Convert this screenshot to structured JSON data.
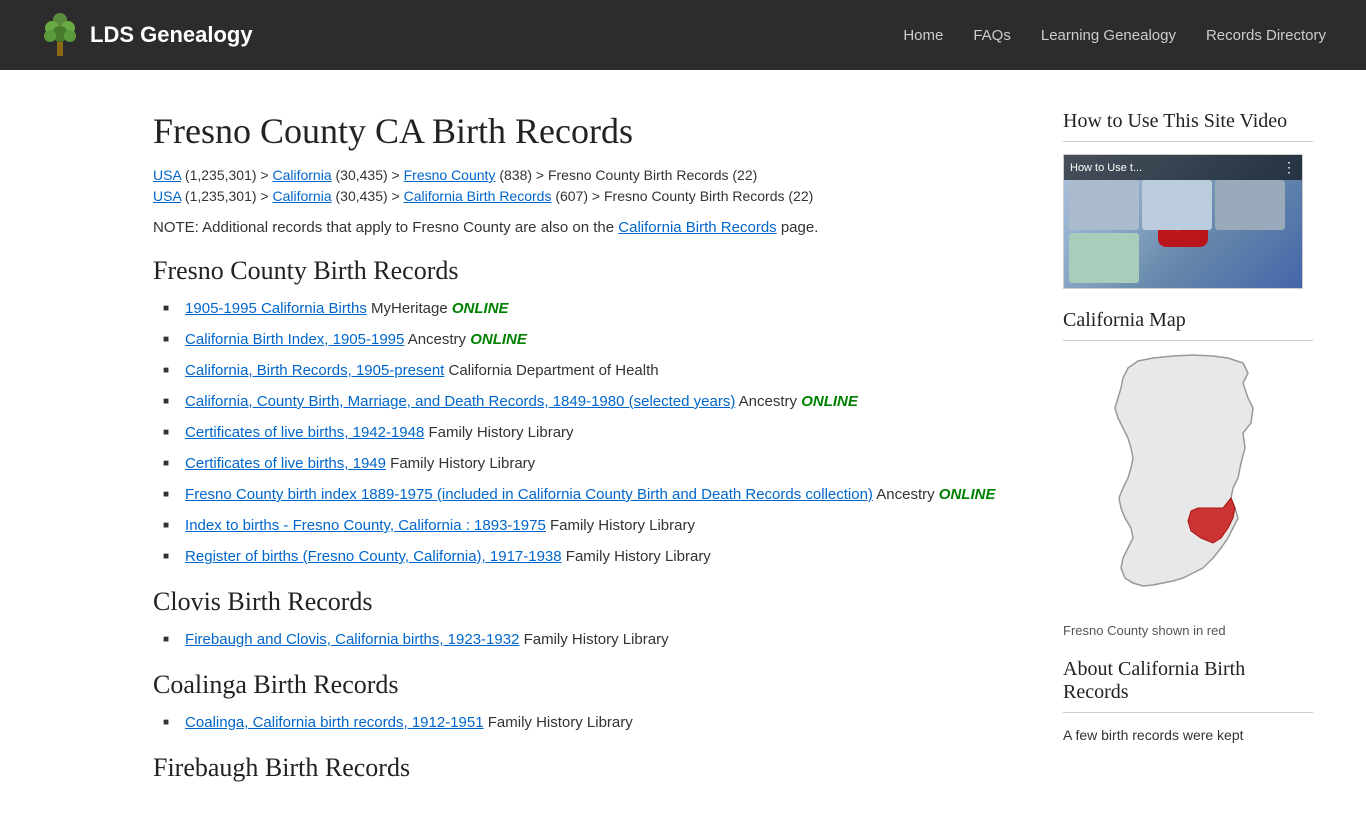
{
  "header": {
    "logo_text": "LDS Genealogy",
    "nav": [
      {
        "label": "Home",
        "key": "home"
      },
      {
        "label": "FAQs",
        "key": "faqs"
      },
      {
        "label": "Learning Genealogy",
        "key": "learning"
      },
      {
        "label": "Records Directory",
        "key": "records"
      }
    ]
  },
  "main": {
    "page_title": "Fresno County CA Birth Records",
    "breadcrumbs": [
      {
        "parts": [
          {
            "text": "USA",
            "link": true
          },
          " (1,235,301) > ",
          {
            "text": "California",
            "link": true
          },
          " (30,435) > ",
          {
            "text": "Fresno County",
            "link": true
          },
          " (838) > Fresno County Birth Records (22)"
        ],
        "raw": "USA (1,235,301) > California (30,435) > Fresno County (838) > Fresno County Birth Records (22)"
      },
      {
        "raw": "USA (1,235,301) > California (30,435) > California Birth Records (607) > Fresno County Birth Records (22)"
      }
    ],
    "note": "NOTE: Additional records that apply to Fresno County are also on the",
    "note_link": "California Birth Records",
    "note_end": "page.",
    "sections": [
      {
        "title": "Fresno County Birth Records",
        "records": [
          {
            "link_text": "1905-1995 California Births",
            "source": "MyHeritage",
            "online": true
          },
          {
            "link_text": "California Birth Index, 1905-1995",
            "source": "Ancestry",
            "online": true
          },
          {
            "link_text": "California, Birth Records, 1905-present",
            "source": "California Department of Health",
            "online": false
          },
          {
            "link_text": "California, County Birth, Marriage, and Death Records, 1849-1980 (selected years)",
            "source": "Ancestry",
            "online": true
          },
          {
            "link_text": "Certificates of live births, 1942-1948",
            "source": "Family History Library",
            "online": false
          },
          {
            "link_text": "Certificates of live births, 1949",
            "source": "Family History Library",
            "online": false
          },
          {
            "link_text": "Fresno County birth index 1889-1975 (included in California County Birth and Death Records collection)",
            "source": "Ancestry",
            "online": true
          },
          {
            "link_text": "Index to births - Fresno County, California : 1893-1975",
            "source": "Family History Library",
            "online": false
          },
          {
            "link_text": "Register of births (Fresno County, California), 1917-1938",
            "source": "Family History Library",
            "online": false
          }
        ]
      },
      {
        "title": "Clovis Birth Records",
        "records": [
          {
            "link_text": "Firebaugh and Clovis, California births, 1923-1932",
            "source": "Family History Library",
            "online": false
          }
        ]
      },
      {
        "title": "Coalinga Birth Records",
        "records": [
          {
            "link_text": "Coalinga, California birth records, 1912-1951",
            "source": "Family History Library",
            "online": false
          }
        ]
      },
      {
        "title": "Firebaugh Birth Records",
        "records": []
      }
    ]
  },
  "sidebar": {
    "video_section_title": "How to Use This Site Video",
    "video_bar_text": "How to Use t...",
    "map_section_title": "California Map",
    "map_caption": "Fresno County shown in red",
    "about_section_title": "About California Birth Records",
    "about_text": "A few birth records were kept"
  },
  "online_label": "ONLINE"
}
